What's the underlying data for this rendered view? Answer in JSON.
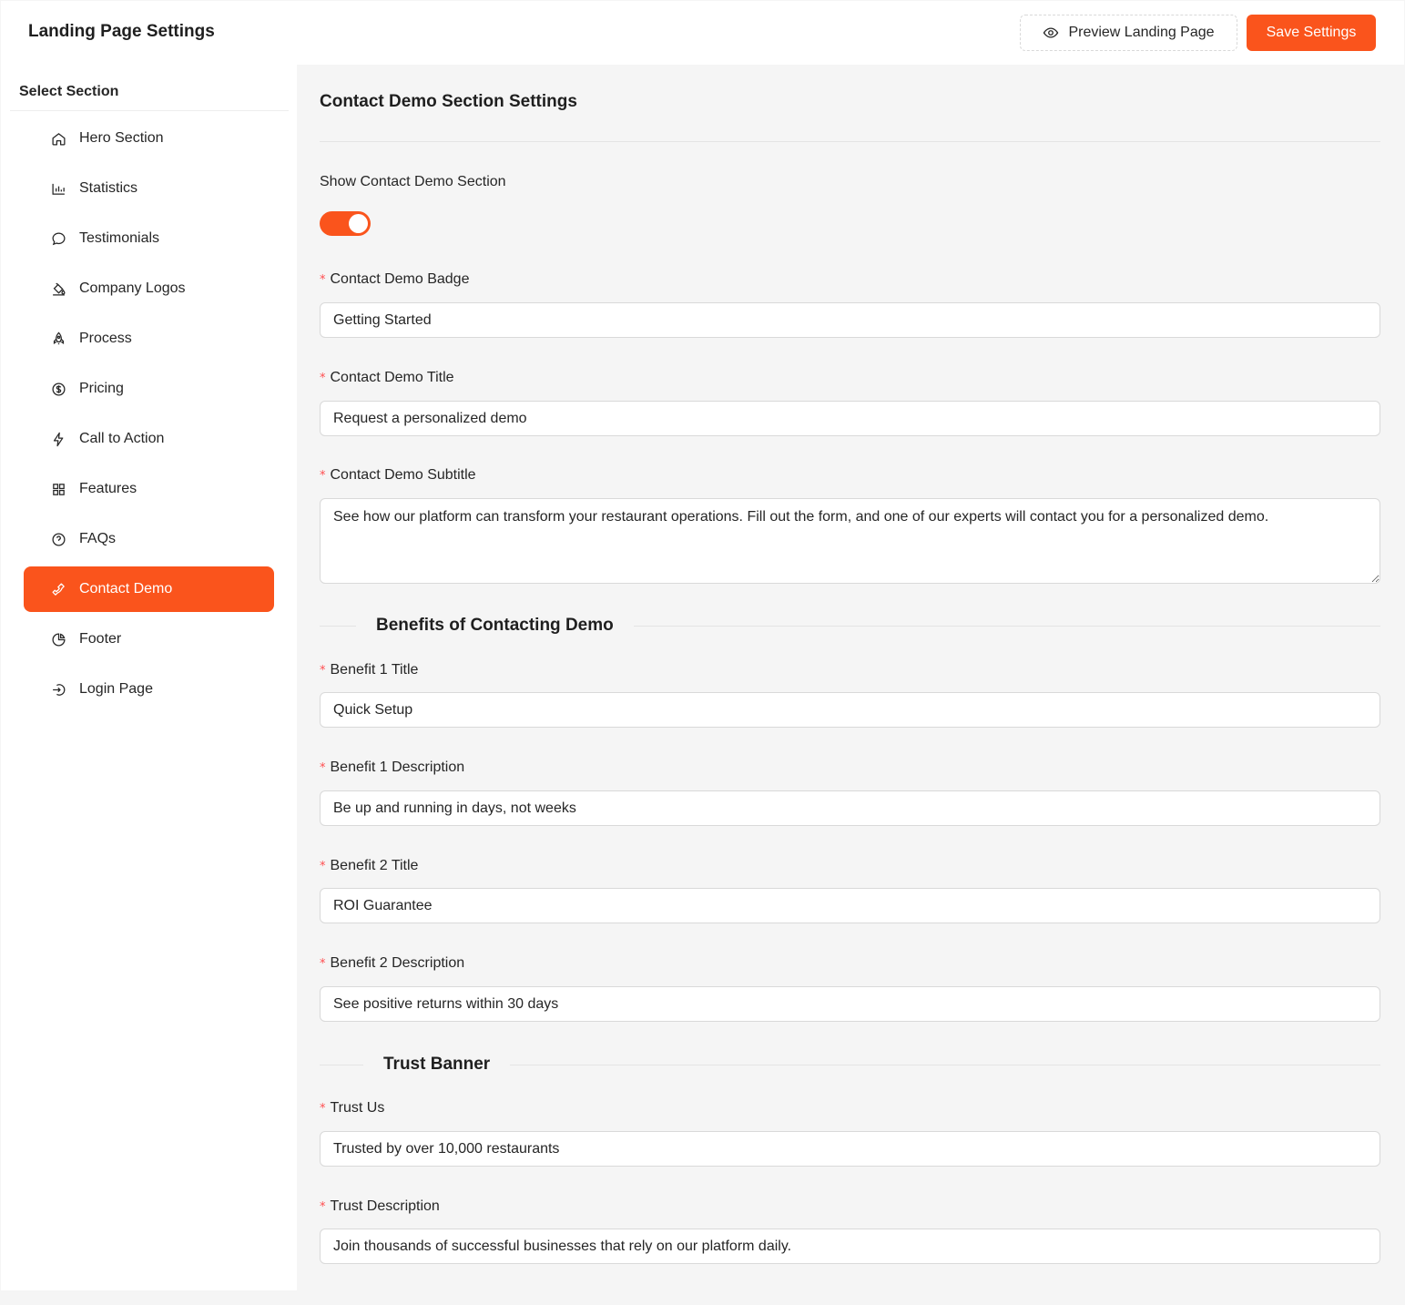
{
  "header": {
    "title": "Landing Page Settings",
    "preview_label": "Preview Landing Page",
    "save_label": "Save Settings"
  },
  "sidebar": {
    "title": "Select Section",
    "items": [
      {
        "label": "Hero Section",
        "icon": "home-icon"
      },
      {
        "label": "Statistics",
        "icon": "bar-chart-icon"
      },
      {
        "label": "Testimonials",
        "icon": "chat-bubble-icon"
      },
      {
        "label": "Company Logos",
        "icon": "paint-bucket-icon"
      },
      {
        "label": "Process",
        "icon": "rocket-icon"
      },
      {
        "label": "Pricing",
        "icon": "dollar-circle-icon"
      },
      {
        "label": "Call to Action",
        "icon": "lightning-icon"
      },
      {
        "label": "Features",
        "icon": "grid-icon"
      },
      {
        "label": "FAQs",
        "icon": "question-circle-icon"
      },
      {
        "label": "Contact Demo",
        "icon": "phone-icon",
        "active": true
      },
      {
        "label": "Footer",
        "icon": "pie-chart-icon"
      },
      {
        "label": "Login Page",
        "icon": "login-icon"
      }
    ]
  },
  "main": {
    "section_title": "Contact Demo Section Settings",
    "show_toggle": {
      "label": "Show Contact Demo Section",
      "on": true
    },
    "badge": {
      "label": "Contact Demo Badge",
      "value": "Getting Started"
    },
    "title": {
      "label": "Contact Demo Title",
      "value": "Request a personalized demo"
    },
    "subtitle": {
      "label": "Contact Demo Subtitle",
      "value": "See how our platform can transform your restaurant operations. Fill out the form, and one of our experts will contact you for a personalized demo."
    },
    "benefits_heading": "Benefits of Contacting Demo",
    "benefit1_title": {
      "label": "Benefit 1 Title",
      "value": "Quick Setup"
    },
    "benefit1_desc": {
      "label": "Benefit 1 Description",
      "value": "Be up and running in days, not weeks"
    },
    "benefit2_title": {
      "label": "Benefit 2 Title",
      "value": "ROI Guarantee"
    },
    "benefit2_desc": {
      "label": "Benefit 2 Description",
      "value": "See positive returns within 30 days"
    },
    "trust_heading": "Trust Banner",
    "trust_us": {
      "label": "Trust Us",
      "value": "Trusted by over 10,000 restaurants"
    },
    "trust_desc": {
      "label": "Trust Description",
      "value": "Join thousands of successful businesses that rely on our platform daily."
    }
  },
  "colors": {
    "accent": "#fa541c",
    "required": "#ff4d4f"
  }
}
